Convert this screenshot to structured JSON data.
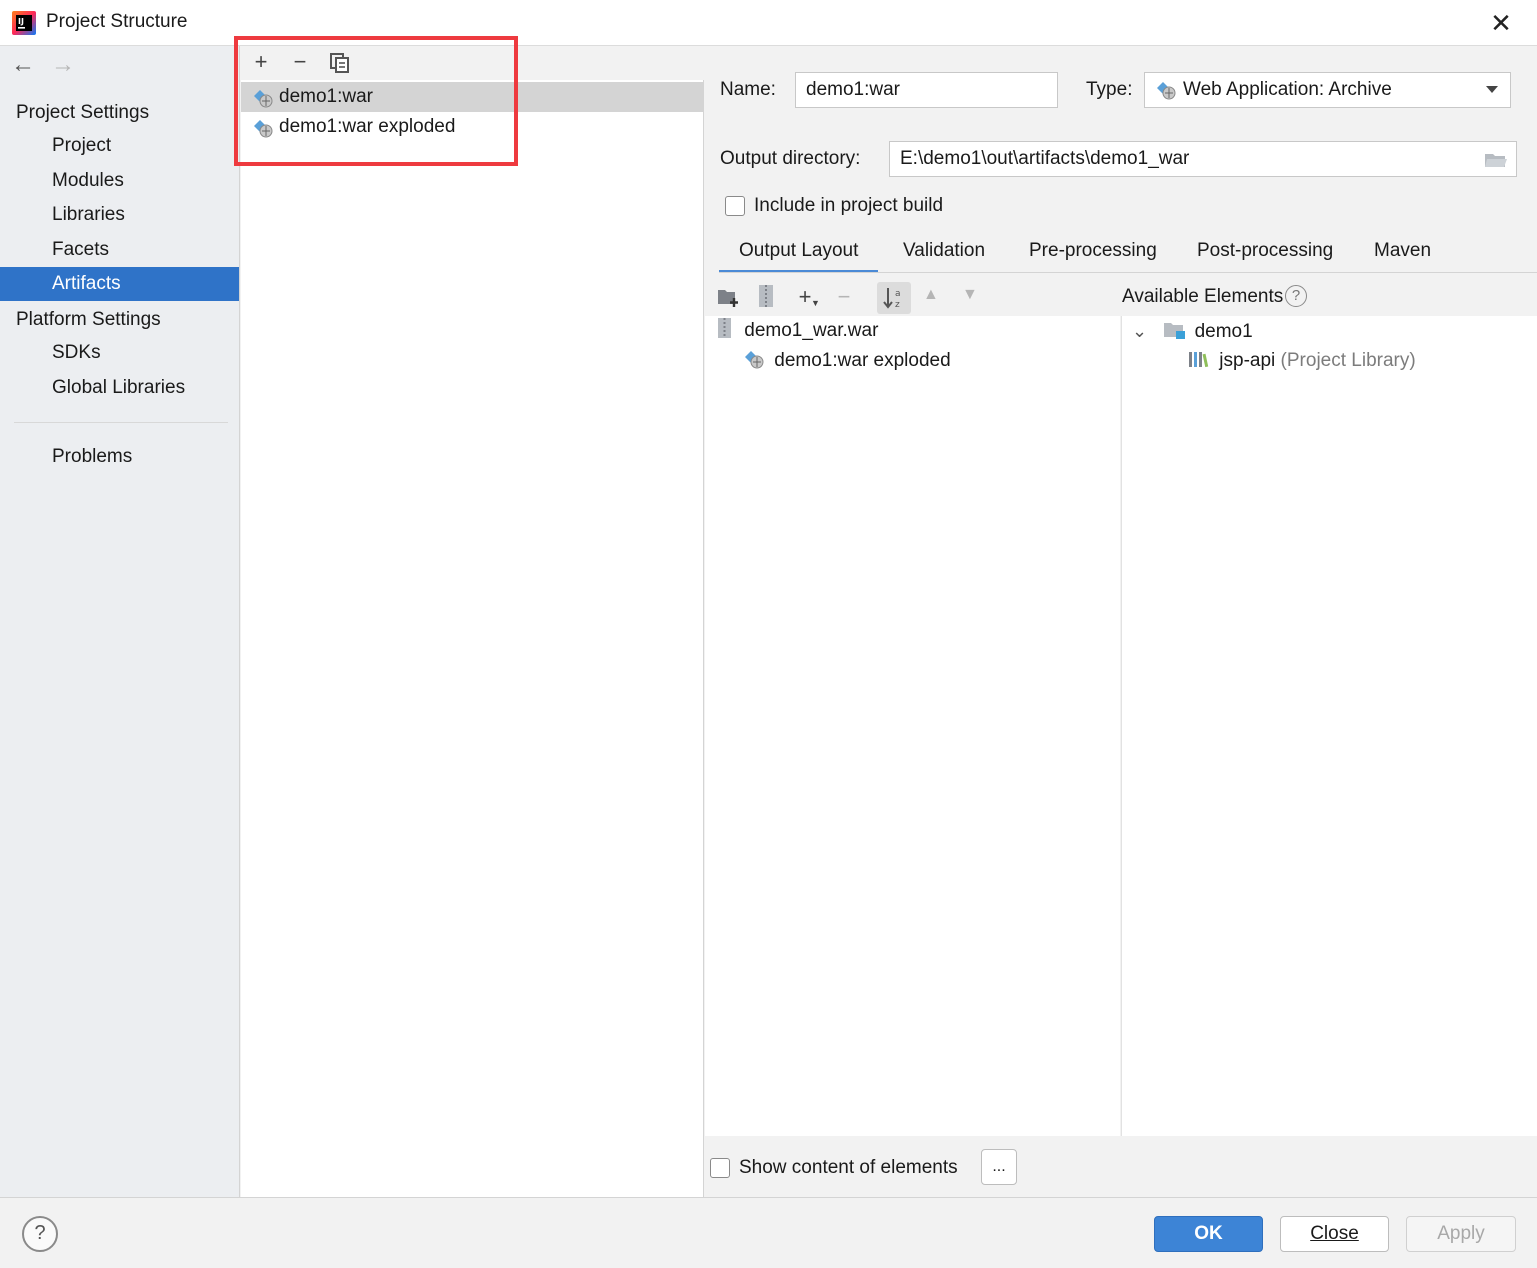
{
  "window": {
    "title": "Project Structure",
    "close_glyph": "✕"
  },
  "nav": {
    "back_glyph": "←",
    "forward_glyph": "→"
  },
  "sidebar": {
    "project_settings_heading": "Project Settings",
    "project_items": [
      "Project",
      "Modules",
      "Libraries",
      "Facets",
      "Artifacts"
    ],
    "selected_item": "Artifacts",
    "platform_settings_heading": "Platform Settings",
    "platform_items": [
      "SDKs",
      "Global Libraries"
    ],
    "problems": "Problems"
  },
  "artifacts_toolbar": {
    "add_glyph": "+",
    "remove_glyph": "−"
  },
  "artifacts": [
    {
      "name": "demo1:war",
      "selected": true
    },
    {
      "name": "demo1:war exploded",
      "selected": false
    }
  ],
  "details": {
    "name_label": "Name:",
    "name_value": "demo1:war",
    "type_label": "Type:",
    "type_value": "Web Application: Archive",
    "output_dir_label": "Output directory:",
    "output_dir_value": "E:\\demo1\\out\\artifacts\\demo1_war",
    "include_build_label": "Include in project build",
    "include_build_checked": false
  },
  "tabs": [
    {
      "label": "Output Layout",
      "active": true
    },
    {
      "label": "Validation",
      "active": false
    },
    {
      "label": "Pre-processing",
      "active": false
    },
    {
      "label": "Post-processing",
      "active": false
    },
    {
      "label": "Maven",
      "active": false
    }
  ],
  "layout_toolbar": {
    "add_glyph": "+",
    "remove_glyph": "−",
    "up_glyph": "▲",
    "down_glyph": "▼"
  },
  "available_elements_label": "Available Elements",
  "output_tree": {
    "root": "demo1_war.war",
    "child": "demo1:war exploded"
  },
  "available_tree": {
    "module": "demo1",
    "library": "jsp-api",
    "library_note": "(Project Library)",
    "expand_glyph": "⌄"
  },
  "show_content": {
    "label": "Show content of elements",
    "checked": false,
    "ellipsis_label": "..."
  },
  "buttons": {
    "ok": "OK",
    "close": "Close",
    "apply": "Apply",
    "help": "?"
  },
  "colors": {
    "selection_blue": "#2f73c8",
    "highlight_red": "#ee3a3f",
    "ok_blue": "#3d84d6"
  }
}
